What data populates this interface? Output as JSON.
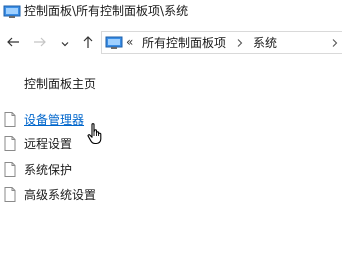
{
  "window": {
    "title": "控制面板\\所有控制面板项\\系统"
  },
  "nav": {
    "back_icon": "arrow-left-icon",
    "forward_icon": "arrow-right-icon",
    "recent_icon": "chevron-down-icon",
    "up_icon": "arrow-up-icon"
  },
  "address": {
    "overflow": "«",
    "crumbs": [
      "所有控制面板项",
      "系统"
    ]
  },
  "sidebar": {
    "home_label": "控制面板主页",
    "tasks": [
      {
        "label": "设备管理器",
        "hovered": true
      },
      {
        "label": "远程设置",
        "hovered": false
      },
      {
        "label": "系统保护",
        "hovered": false
      },
      {
        "label": "高级系统设置",
        "hovered": false
      }
    ]
  },
  "colors": {
    "link_hover": "#0066cc",
    "text": "#1a1a1a",
    "border": "#d9d9d9"
  }
}
